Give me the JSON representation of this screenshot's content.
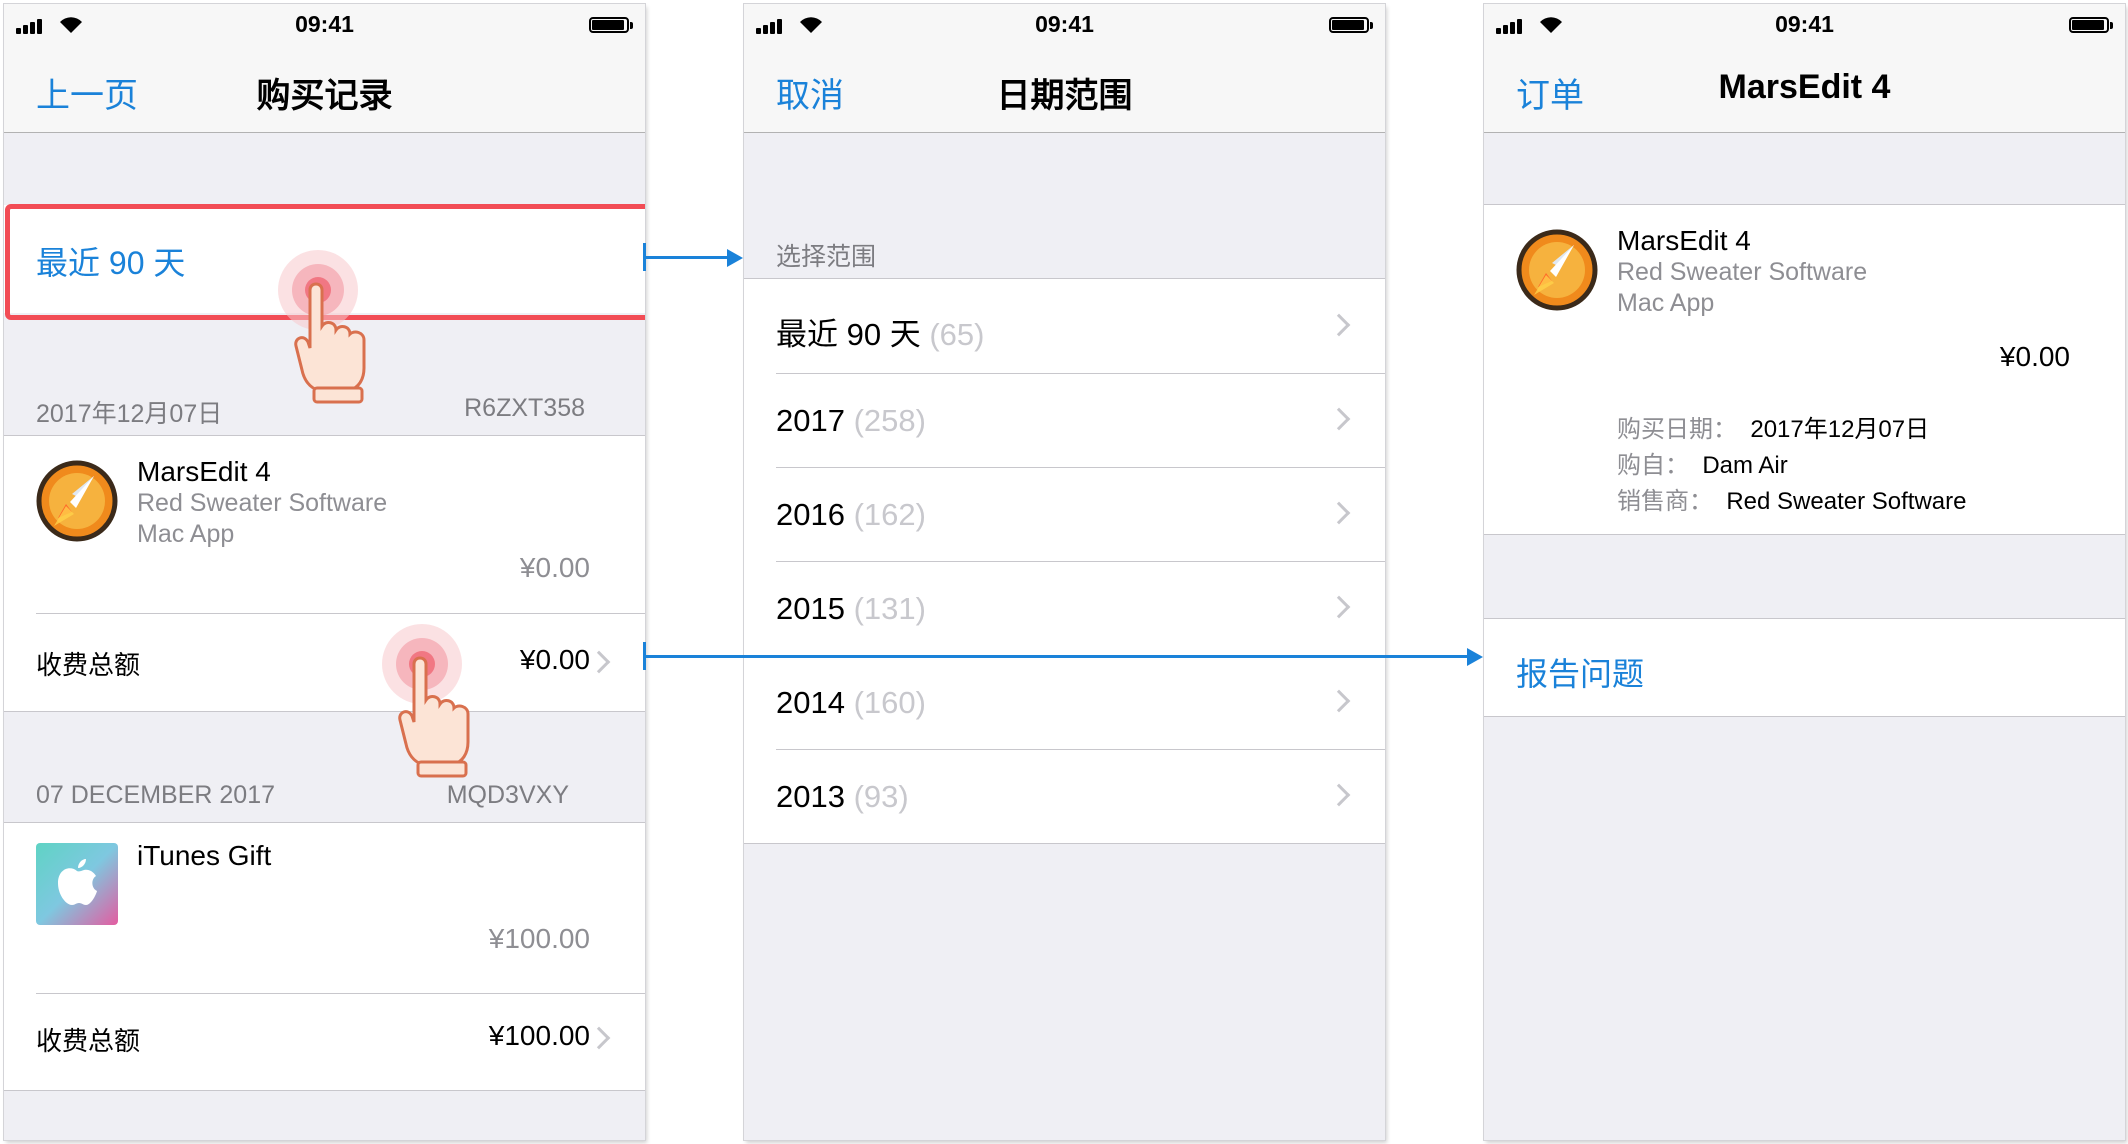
{
  "status": {
    "time": "09:41"
  },
  "screen1": {
    "nav": {
      "back": "上一页",
      "title": "购买记录"
    },
    "recent": "最近 90 天",
    "group1": {
      "date": "2017年12月07日",
      "order_id": "R6ZXT358",
      "app_name": "MarsEdit 4",
      "developer": "Red Sweater Software",
      "kind": "Mac App",
      "price": "¥0.00",
      "total_label": "收费总额",
      "total": "¥0.00"
    },
    "group2": {
      "date": "07 DECEMBER 2017",
      "order_id": "MQD3VXY",
      "app_name": "iTunes Gift",
      "price": "¥100.00",
      "total_label": "收费总额",
      "total": "¥100.00"
    }
  },
  "screen2": {
    "nav": {
      "back": "取消",
      "title": "日期范围"
    },
    "section_header": "选择范围",
    "ranges": [
      {
        "label": "最近 90 天",
        "count": "(65)"
      },
      {
        "label": "2017",
        "count": "(258)"
      },
      {
        "label": "2016",
        "count": "(162)"
      },
      {
        "label": "2015",
        "count": "(131)"
      },
      {
        "label": "2014",
        "count": "(160)"
      },
      {
        "label": "2013",
        "count": "(93)"
      }
    ]
  },
  "screen3": {
    "nav": {
      "back": "订单",
      "title": "MarsEdit 4"
    },
    "app_name": "MarsEdit 4",
    "developer": "Red Sweater Software",
    "kind": "Mac App",
    "price": "¥0.00",
    "details": [
      {
        "label": "购买日期：",
        "value": "2017年12月07日"
      },
      {
        "label": "购自：",
        "value": "Dam Air"
      },
      {
        "label": "销售商：",
        "value": "Red Sweater Software"
      }
    ],
    "report": "报告问题"
  },
  "colors": {
    "accent": "#1a82d9",
    "highlight_border": "#f24c55",
    "background": "#efeff4"
  }
}
